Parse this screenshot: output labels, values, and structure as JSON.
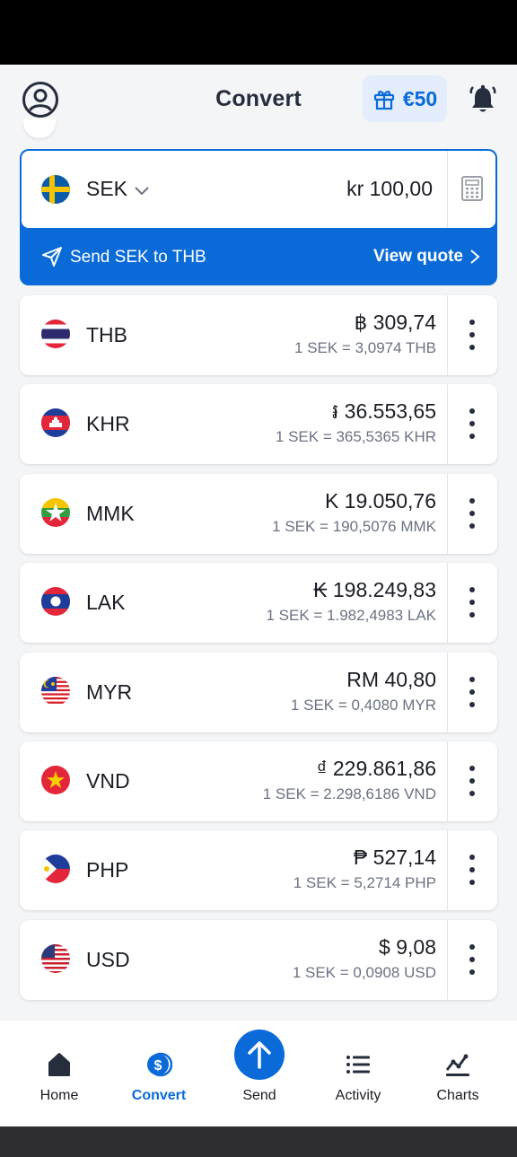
{
  "header": {
    "title": "Convert",
    "reward_amount": "€50"
  },
  "base": {
    "currency_code": "SEK",
    "amount": "kr 100,00",
    "send_label": "Send SEK to THB",
    "view_quote_label": "View quote"
  },
  "conversions": [
    {
      "code": "THB",
      "value": "฿ 309,74",
      "rate": "1 SEK = 3,0974 THB"
    },
    {
      "code": "KHR",
      "value": "៛ 36.553,65",
      "rate": "1 SEK = 365,5365 KHR"
    },
    {
      "code": "MMK",
      "value": "K 19.050,76",
      "rate": "1 SEK = 190,5076 MMK"
    },
    {
      "code": "LAK",
      "value": "₭ 198.249,83",
      "rate": "1 SEK = 1.982,4983 LAK"
    },
    {
      "code": "MYR",
      "value": "RM 40,80",
      "rate": "1 SEK = 0,4080 MYR"
    },
    {
      "code": "VND",
      "value": "₫ 229.861,86",
      "rate": "1 SEK = 2.298,6186 VND"
    },
    {
      "code": "PHP",
      "value": "₱ 527,14",
      "rate": "1 SEK = 5,2714 PHP"
    },
    {
      "code": "USD",
      "value": "$ 9,08",
      "rate": "1 SEK = 0,0908 USD"
    }
  ],
  "nav": {
    "home": "Home",
    "convert": "Convert",
    "send": "Send",
    "activity": "Activity",
    "charts": "Charts"
  },
  "colors": {
    "accent": "#0a6ad8",
    "text": "#1a1d24",
    "muted": "#6b7280"
  },
  "icons": {
    "profile": "user-circle-icon",
    "reward": "gift-icon",
    "notifications": "bell-icon",
    "calculator": "calculator-icon",
    "send": "paper-plane-icon",
    "more": "more-vertical-icon"
  }
}
